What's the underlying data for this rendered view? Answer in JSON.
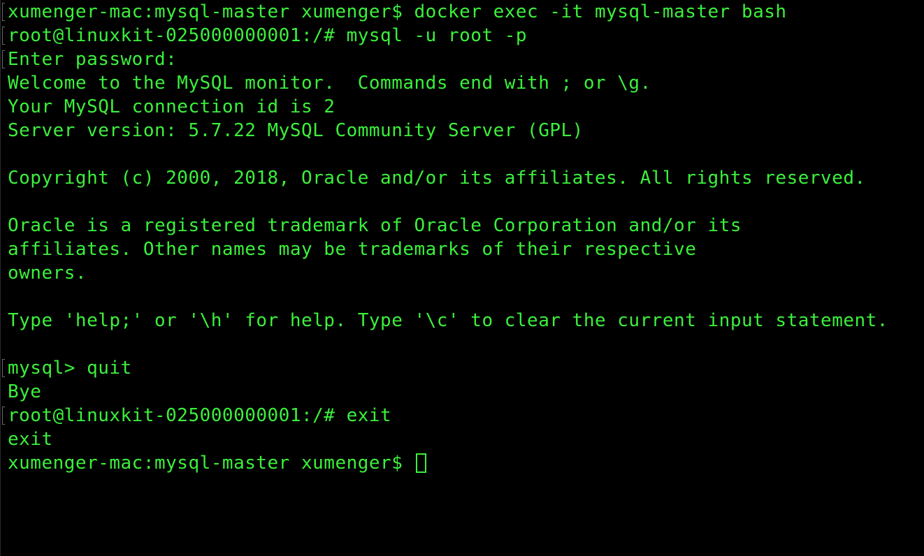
{
  "terminal": {
    "colors": {
      "background": "#000000",
      "text": "#3bf03b"
    },
    "lines": [
      "xumenger-mac:mysql-master xumenger$ docker exec -it mysql-master bash",
      "root@linuxkit-025000000001:/# mysql -u root -p",
      "Enter password:",
      "Welcome to the MySQL monitor.  Commands end with ; or \\g.",
      "Your MySQL connection id is 2",
      "Server version: 5.7.22 MySQL Community Server (GPL)",
      "",
      "Copyright (c) 2000, 2018, Oracle and/or its affiliates. All rights reserved.",
      "",
      "Oracle is a registered trademark of Oracle Corporation and/or its",
      "affiliates. Other names may be trademarks of their respective",
      "owners.",
      "",
      "Type 'help;' or '\\h' for help. Type '\\c' to clear the current input statement.",
      "",
      "mysql> quit",
      "Bye",
      "root@linuxkit-025000000001:/# exit",
      "exit"
    ],
    "prompt": "xumenger-mac:mysql-master xumenger$ "
  }
}
